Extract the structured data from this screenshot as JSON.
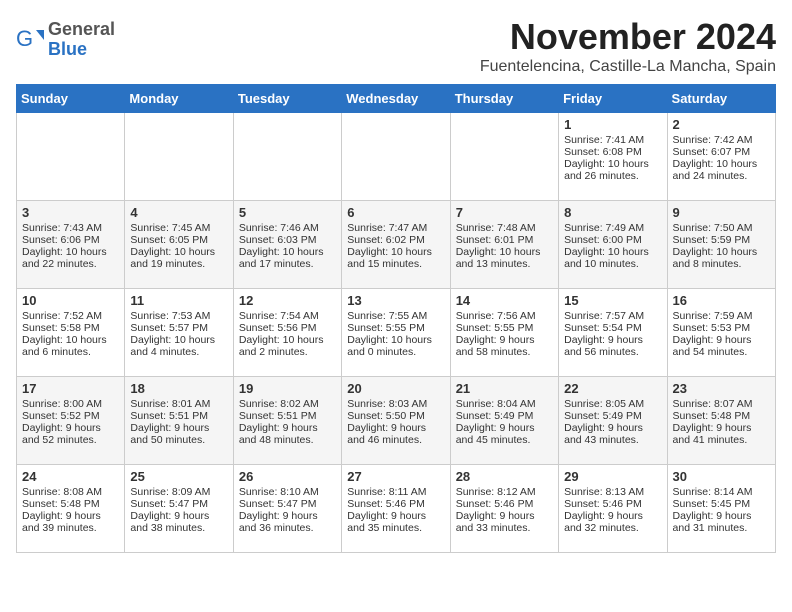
{
  "logo": {
    "general": "General",
    "blue": "Blue"
  },
  "header": {
    "month": "November 2024",
    "location": "Fuentelencina, Castille-La Mancha, Spain"
  },
  "weekdays": [
    "Sunday",
    "Monday",
    "Tuesday",
    "Wednesday",
    "Thursday",
    "Friday",
    "Saturday"
  ],
  "weeks": [
    [
      {
        "day": "",
        "info": ""
      },
      {
        "day": "",
        "info": ""
      },
      {
        "day": "",
        "info": ""
      },
      {
        "day": "",
        "info": ""
      },
      {
        "day": "",
        "info": ""
      },
      {
        "day": "1",
        "info": "Sunrise: 7:41 AM\nSunset: 6:08 PM\nDaylight: 10 hours\nand 26 minutes."
      },
      {
        "day": "2",
        "info": "Sunrise: 7:42 AM\nSunset: 6:07 PM\nDaylight: 10 hours\nand 24 minutes."
      }
    ],
    [
      {
        "day": "3",
        "info": "Sunrise: 7:43 AM\nSunset: 6:06 PM\nDaylight: 10 hours\nand 22 minutes."
      },
      {
        "day": "4",
        "info": "Sunrise: 7:45 AM\nSunset: 6:05 PM\nDaylight: 10 hours\nand 19 minutes."
      },
      {
        "day": "5",
        "info": "Sunrise: 7:46 AM\nSunset: 6:03 PM\nDaylight: 10 hours\nand 17 minutes."
      },
      {
        "day": "6",
        "info": "Sunrise: 7:47 AM\nSunset: 6:02 PM\nDaylight: 10 hours\nand 15 minutes."
      },
      {
        "day": "7",
        "info": "Sunrise: 7:48 AM\nSunset: 6:01 PM\nDaylight: 10 hours\nand 13 minutes."
      },
      {
        "day": "8",
        "info": "Sunrise: 7:49 AM\nSunset: 6:00 PM\nDaylight: 10 hours\nand 10 minutes."
      },
      {
        "day": "9",
        "info": "Sunrise: 7:50 AM\nSunset: 5:59 PM\nDaylight: 10 hours\nand 8 minutes."
      }
    ],
    [
      {
        "day": "10",
        "info": "Sunrise: 7:52 AM\nSunset: 5:58 PM\nDaylight: 10 hours\nand 6 minutes."
      },
      {
        "day": "11",
        "info": "Sunrise: 7:53 AM\nSunset: 5:57 PM\nDaylight: 10 hours\nand 4 minutes."
      },
      {
        "day": "12",
        "info": "Sunrise: 7:54 AM\nSunset: 5:56 PM\nDaylight: 10 hours\nand 2 minutes."
      },
      {
        "day": "13",
        "info": "Sunrise: 7:55 AM\nSunset: 5:55 PM\nDaylight: 10 hours\nand 0 minutes."
      },
      {
        "day": "14",
        "info": "Sunrise: 7:56 AM\nSunset: 5:55 PM\nDaylight: 9 hours\nand 58 minutes."
      },
      {
        "day": "15",
        "info": "Sunrise: 7:57 AM\nSunset: 5:54 PM\nDaylight: 9 hours\nand 56 minutes."
      },
      {
        "day": "16",
        "info": "Sunrise: 7:59 AM\nSunset: 5:53 PM\nDaylight: 9 hours\nand 54 minutes."
      }
    ],
    [
      {
        "day": "17",
        "info": "Sunrise: 8:00 AM\nSunset: 5:52 PM\nDaylight: 9 hours\nand 52 minutes."
      },
      {
        "day": "18",
        "info": "Sunrise: 8:01 AM\nSunset: 5:51 PM\nDaylight: 9 hours\nand 50 minutes."
      },
      {
        "day": "19",
        "info": "Sunrise: 8:02 AM\nSunset: 5:51 PM\nDaylight: 9 hours\nand 48 minutes."
      },
      {
        "day": "20",
        "info": "Sunrise: 8:03 AM\nSunset: 5:50 PM\nDaylight: 9 hours\nand 46 minutes."
      },
      {
        "day": "21",
        "info": "Sunrise: 8:04 AM\nSunset: 5:49 PM\nDaylight: 9 hours\nand 45 minutes."
      },
      {
        "day": "22",
        "info": "Sunrise: 8:05 AM\nSunset: 5:49 PM\nDaylight: 9 hours\nand 43 minutes."
      },
      {
        "day": "23",
        "info": "Sunrise: 8:07 AM\nSunset: 5:48 PM\nDaylight: 9 hours\nand 41 minutes."
      }
    ],
    [
      {
        "day": "24",
        "info": "Sunrise: 8:08 AM\nSunset: 5:48 PM\nDaylight: 9 hours\nand 39 minutes."
      },
      {
        "day": "25",
        "info": "Sunrise: 8:09 AM\nSunset: 5:47 PM\nDaylight: 9 hours\nand 38 minutes."
      },
      {
        "day": "26",
        "info": "Sunrise: 8:10 AM\nSunset: 5:47 PM\nDaylight: 9 hours\nand 36 minutes."
      },
      {
        "day": "27",
        "info": "Sunrise: 8:11 AM\nSunset: 5:46 PM\nDaylight: 9 hours\nand 35 minutes."
      },
      {
        "day": "28",
        "info": "Sunrise: 8:12 AM\nSunset: 5:46 PM\nDaylight: 9 hours\nand 33 minutes."
      },
      {
        "day": "29",
        "info": "Sunrise: 8:13 AM\nSunset: 5:46 PM\nDaylight: 9 hours\nand 32 minutes."
      },
      {
        "day": "30",
        "info": "Sunrise: 8:14 AM\nSunset: 5:45 PM\nDaylight: 9 hours\nand 31 minutes."
      }
    ]
  ]
}
